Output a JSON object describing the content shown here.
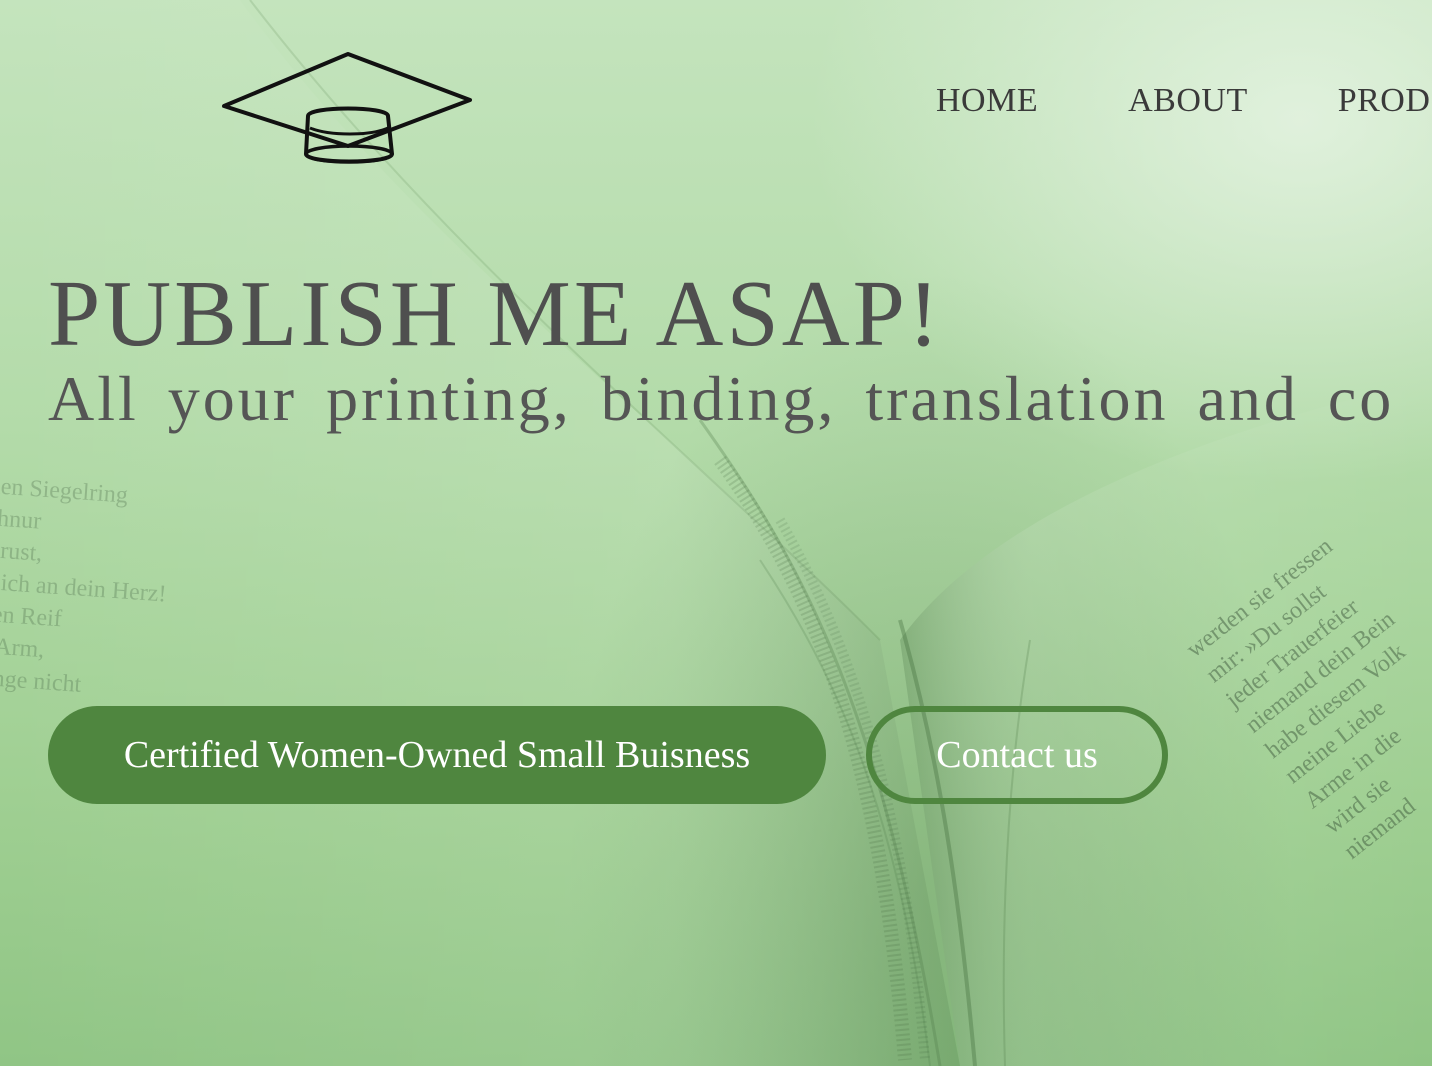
{
  "header": {
    "logo_icon": "graduation-cap-icon",
    "nav": [
      {
        "label": "HOME"
      },
      {
        "label": "ABOUT"
      },
      {
        "label": "PROD"
      }
    ]
  },
  "hero": {
    "title": "PUBLISH ME ASAP!",
    "subtitle": "All your printing, binding, translation and co"
  },
  "buttons": {
    "certified_label": "Certified Women-Owned Small Buisness",
    "contact_label": "Contact us"
  },
  "colors": {
    "accent_green": "#4f863f",
    "text_dark": "#4f4f4f",
    "background_green": "#a7d29c"
  }
}
